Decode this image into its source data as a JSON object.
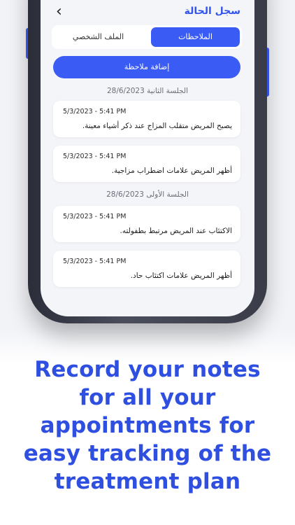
{
  "header": {
    "back_icon": "chevron-left-icon",
    "title": "سجل الحالة"
  },
  "tabs": [
    {
      "label": "الملاحظات",
      "active": true
    },
    {
      "label": "الملف الشخصي",
      "active": false
    }
  ],
  "add_note_button": "إضافة ملاحظة",
  "sessions": [
    {
      "label": "الجلسة الثانية 28/6/2023",
      "notes": [
        {
          "time": "5/3/2023 - 5:41 PM",
          "text": "يصبح المريض متقلب المزاج عند ذكر أشياء معينة."
        },
        {
          "time": "5/3/2023 - 5:41 PM",
          "text": "أظهر المريض علامات اضطراب مزاجية."
        }
      ]
    },
    {
      "label": "الجلسة الأولى 28/6/2023",
      "notes": [
        {
          "time": "5/3/2023 - 5:41 PM",
          "text": "الاكتئاب عند المريض مرتبط بطفولته."
        },
        {
          "time": "5/3/2023 - 5:41 PM",
          "text": "أظهر المريض علامات اكتئاب حاد."
        }
      ]
    }
  ],
  "caption": {
    "lines": [
      "Record your notes",
      "for all your",
      "appointments for",
      "easy tracking of the",
      "treatment plan"
    ]
  },
  "colors": {
    "accent": "#3b5bf5",
    "title": "#3554e8",
    "caption": "#2f4fe0",
    "screen_bg": "#f4f5f8"
  }
}
